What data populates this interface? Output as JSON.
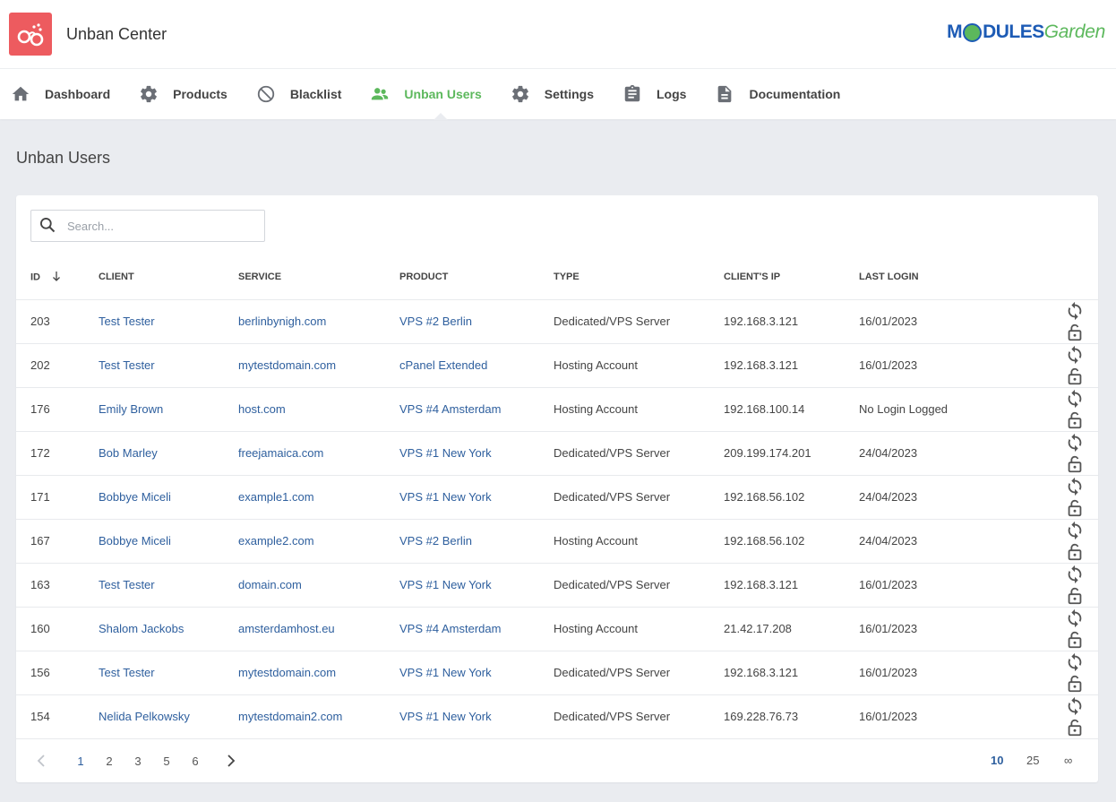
{
  "app": {
    "title": "Unban Center"
  },
  "brand": {
    "part1": "M",
    "part2": "DULES",
    "part3": "Garden"
  },
  "nav": [
    {
      "key": "dashboard",
      "label": "Dashboard",
      "icon": "home-icon",
      "active": false
    },
    {
      "key": "products",
      "label": "Products",
      "icon": "gear-icon",
      "active": false
    },
    {
      "key": "blacklist",
      "label": "Blacklist",
      "icon": "block-icon",
      "active": false
    },
    {
      "key": "unban-users",
      "label": "Unban Users",
      "icon": "users-icon",
      "active": true
    },
    {
      "key": "settings",
      "label": "Settings",
      "icon": "gear-icon",
      "active": false
    },
    {
      "key": "logs",
      "label": "Logs",
      "icon": "clipboard-icon",
      "active": false
    },
    {
      "key": "documentation",
      "label": "Documentation",
      "icon": "document-icon",
      "active": false
    }
  ],
  "page": {
    "title": "Unban Users"
  },
  "search": {
    "placeholder": "Search...",
    "value": ""
  },
  "table": {
    "columns": [
      "ID",
      "CLIENT",
      "SERVICE",
      "PRODUCT",
      "TYPE",
      "CLIENT'S IP",
      "LAST LOGIN"
    ],
    "rows": [
      {
        "id": "203",
        "client": "Test Tester",
        "service": "berlinbynigh.com",
        "product": "VPS #2 Berlin",
        "type": "Dedicated/VPS Server",
        "ip": "192.168.3.121",
        "last_login": "16/01/2023"
      },
      {
        "id": "202",
        "client": "Test Tester",
        "service": "mytestdomain.com",
        "product": "cPanel Extended",
        "type": "Hosting Account",
        "ip": "192.168.3.121",
        "last_login": "16/01/2023"
      },
      {
        "id": "176",
        "client": "Emily Brown",
        "service": "host.com",
        "product": "VPS #4 Amsterdam",
        "type": "Hosting Account",
        "ip": "192.168.100.14",
        "last_login": "No Login Logged"
      },
      {
        "id": "172",
        "client": "Bob Marley",
        "service": "freejamaica.com",
        "product": "VPS #1 New York",
        "type": "Dedicated/VPS Server",
        "ip": "209.199.174.201",
        "last_login": "24/04/2023"
      },
      {
        "id": "171",
        "client": "Bobbye Miceli",
        "service": "example1.com",
        "product": "VPS #1 New York",
        "type": "Dedicated/VPS Server",
        "ip": "192.168.56.102",
        "last_login": "24/04/2023"
      },
      {
        "id": "167",
        "client": "Bobbye Miceli",
        "service": "example2.com",
        "product": "VPS #2 Berlin",
        "type": "Hosting Account",
        "ip": "192.168.56.102",
        "last_login": "24/04/2023"
      },
      {
        "id": "163",
        "client": "Test Tester",
        "service": "domain.com",
        "product": "VPS #1 New York",
        "type": "Dedicated/VPS Server",
        "ip": "192.168.3.121",
        "last_login": "16/01/2023"
      },
      {
        "id": "160",
        "client": "Shalom Jackobs",
        "service": "amsterdamhost.eu",
        "product": "VPS #4 Amsterdam",
        "type": "Hosting Account",
        "ip": "21.42.17.208",
        "last_login": "16/01/2023"
      },
      {
        "id": "156",
        "client": "Test Tester",
        "service": "mytestdomain.com",
        "product": "VPS #1 New York",
        "type": "Dedicated/VPS Server",
        "ip": "192.168.3.121",
        "last_login": "16/01/2023"
      },
      {
        "id": "154",
        "client": "Nelida Pelkowsky",
        "service": "mytestdomain2.com",
        "product": "VPS #1 New York",
        "type": "Dedicated/VPS Server",
        "ip": "169.228.76.73",
        "last_login": "16/01/2023"
      }
    ]
  },
  "pagination": {
    "pages": [
      "1",
      "2",
      "3",
      "5",
      "6"
    ],
    "current": "1",
    "per_page": [
      "10",
      "25",
      "∞"
    ],
    "per_page_current": "10"
  },
  "colors": {
    "accent": "#5cb85c",
    "link": "#2e5f9e",
    "logo_bg": "#ed5b5f",
    "brand_blue": "#1d5bb5"
  }
}
